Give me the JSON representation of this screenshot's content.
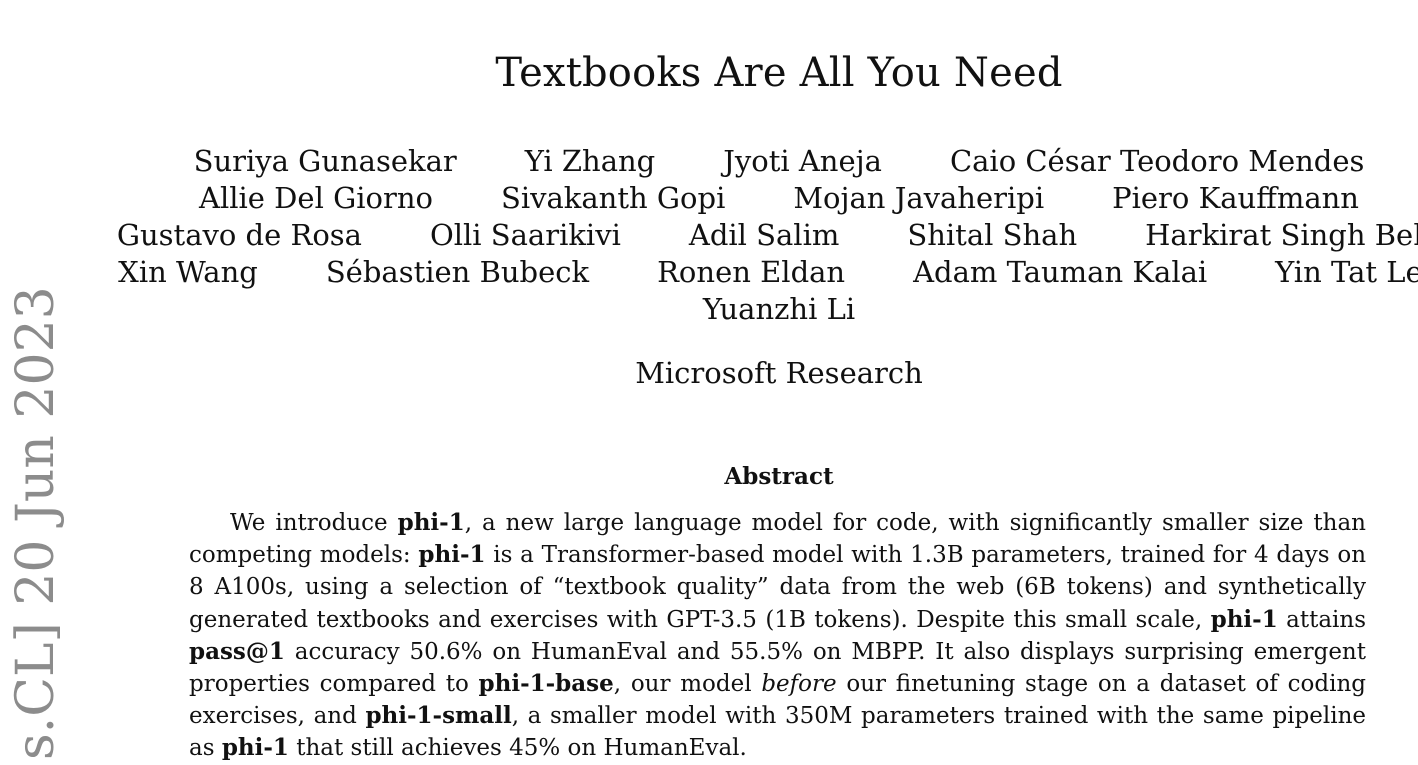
{
  "paper": {
    "title": "Textbooks Are All You Need",
    "author_rows": [
      [
        "Suriya Gunasekar",
        "Yi Zhang",
        "Jyoti Aneja",
        "Caio César Teodoro Mendes"
      ],
      [
        "Allie Del Giorno",
        "Sivakanth Gopi",
        "Mojan Javaheripi",
        "Piero Kauffmann"
      ],
      [
        "Gustavo de Rosa",
        "Olli Saarikivi",
        "Adil Salim",
        "Shital Shah",
        "Harkirat Singh Behl"
      ],
      [
        "Xin Wang",
        "Sébastien Bubeck",
        "Ronen Eldan",
        "Adam Tauman Kalai",
        "Yin Tat Lee"
      ],
      [
        "Yuanzhi Li"
      ]
    ],
    "affiliation": "Microsoft Research",
    "abstract_heading": "Abstract",
    "abstract_segments": [
      {
        "text": "We introduce ",
        "style": "normal"
      },
      {
        "text": "phi-1",
        "style": "bold"
      },
      {
        "text": ", a new large language model for code, with significantly smaller size than competing models: ",
        "style": "normal"
      },
      {
        "text": "phi-1",
        "style": "bold"
      },
      {
        "text": " is a Transformer-based model with 1.3B parameters, trained for 4 days on 8 A100s, using a selection of “textbook quality” data from the web (6B tokens) and synthetically generated textbooks and exercises with GPT-3.5 (1B tokens). Despite this small scale, ",
        "style": "normal"
      },
      {
        "text": "phi-1",
        "style": "bold"
      },
      {
        "text": " attains ",
        "style": "normal"
      },
      {
        "text": "pass@1",
        "style": "bold"
      },
      {
        "text": " accuracy 50.6% on HumanEval and 55.5% on MBPP. It also displays surprising emergent properties compared to ",
        "style": "normal"
      },
      {
        "text": "phi-1-base",
        "style": "bold"
      },
      {
        "text": ", our model ",
        "style": "normal"
      },
      {
        "text": "before",
        "style": "italic"
      },
      {
        "text": " our finetuning stage on a dataset of coding exercises, and ",
        "style": "normal"
      },
      {
        "text": "phi-1-small",
        "style": "bold"
      },
      {
        "text": ", a smaller model with 350M parameters trained with the same pipeline as ",
        "style": "normal"
      },
      {
        "text": "phi-1",
        "style": "bold"
      },
      {
        "text": " that still achieves 45% on HumanEval.",
        "style": "normal"
      }
    ],
    "side_stamp": "s.CL]  20 Jun 2023"
  }
}
